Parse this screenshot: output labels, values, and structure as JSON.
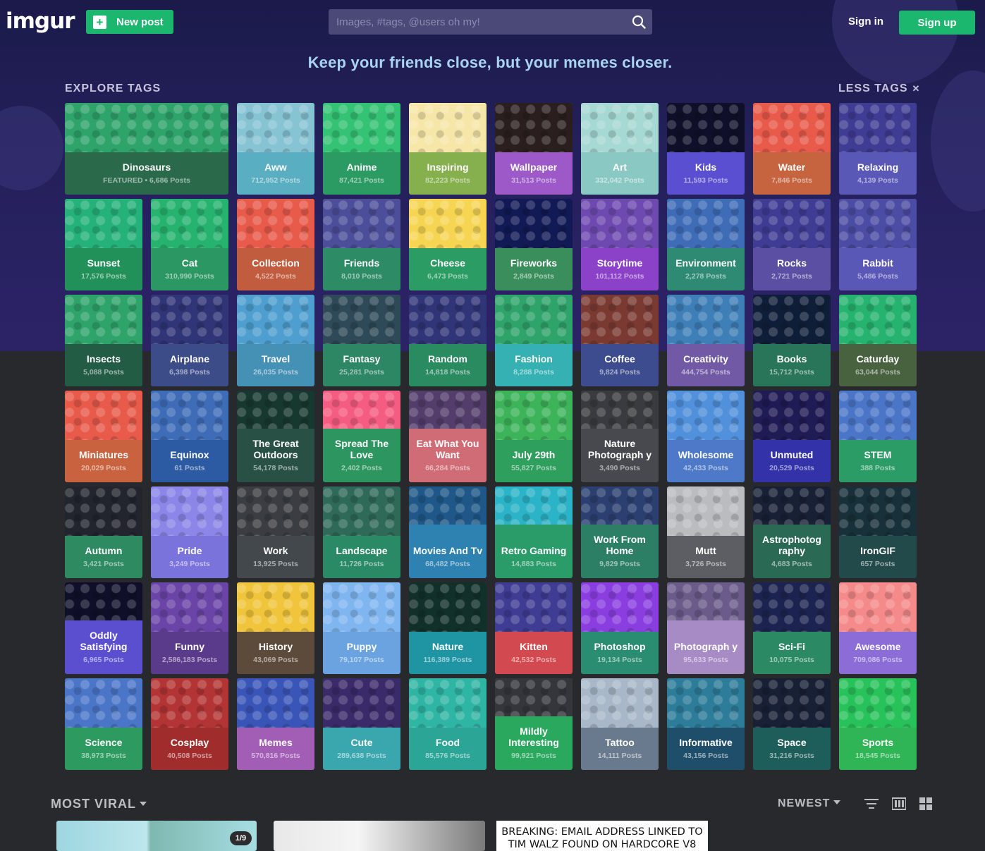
{
  "header": {
    "logo": "imgur",
    "new_post": "New post",
    "search_placeholder": "Images, #tags, @users oh my!",
    "sign_in": "Sign in",
    "sign_up": "Sign up"
  },
  "tagline": "Keep your friends close, but your memes closer.",
  "explore": {
    "title": "EXPLORE TAGS",
    "less_tags": "LESS TAGS",
    "less_tags_icon": "close-icon"
  },
  "tags": [
    {
      "name": "Dinosaurs",
      "count": "FEATURED • 6,686 Posts",
      "color": "#2a6a4a",
      "art": "#2ea36a",
      "featured": true
    },
    {
      "name": "Aww",
      "count": "712,952 Posts",
      "color": "#5aaec1",
      "art": "#86c3d3"
    },
    {
      "name": "Anime",
      "count": "87,421 Posts",
      "color": "#2c9b63",
      "art": "#34c274"
    },
    {
      "name": "Inspiring",
      "count": "82,223 Posts",
      "color": "#86b04e",
      "art": "#f6e6a8"
    },
    {
      "name": "Wallpaper",
      "count": "31,513 Posts",
      "color": "#9c59c7",
      "art": "#2b1e1e"
    },
    {
      "name": "Art",
      "count": "332,042 Posts",
      "color": "#8ac9c3",
      "art": "#a6d8d4"
    },
    {
      "name": "Kids",
      "count": "11,593 Posts",
      "color": "#5a4fd1",
      "art": "#0f0f2a"
    },
    {
      "name": "Water",
      "count": "7,846 Posts",
      "color": "#c6643f",
      "art": "#e85a4a"
    },
    {
      "name": "Relaxing",
      "count": "4,139 Posts",
      "color": "#5a58b7",
      "art": "#3e3c93"
    },
    {
      "name": "Sunset",
      "count": "17,576 Posts",
      "color": "#229059",
      "art": "#25b27a"
    },
    {
      "name": "Cat",
      "count": "310,990 Posts",
      "color": "#2b9763",
      "art": "#26b36f"
    },
    {
      "name": "Collection",
      "count": "4,522 Posts",
      "color": "#c15c3e",
      "art": "#e85a4a"
    },
    {
      "name": "Friends",
      "count": "8,010 Posts",
      "color": "#2d8b66",
      "art": "#4d4e9a"
    },
    {
      "name": "Cheese",
      "count": "6,473 Posts",
      "color": "#2b9c64",
      "art": "#f6d553"
    },
    {
      "name": "Fireworks",
      "count": "2,849 Posts",
      "color": "#3a8e5c",
      "art": "#111a55"
    },
    {
      "name": "Storytime",
      "count": "101,112 Posts",
      "color": "#8c42c8",
      "art": "#6e4ab0"
    },
    {
      "name": "Environment",
      "count": "2,278 Posts",
      "color": "#2e8a73",
      "art": "#3e6cb7"
    },
    {
      "name": "Rocks",
      "count": "2,721 Posts",
      "color": "#5a4fa3",
      "art": "#3e3c93"
    },
    {
      "name": "Rabbit",
      "count": "5,486 Posts",
      "color": "#5a58b7",
      "art": "#4b4ca3"
    },
    {
      "name": "Insects",
      "count": "5,088 Posts",
      "color": "#235c44",
      "art": "#2ea36a"
    },
    {
      "name": "Airplane",
      "count": "6,398 Posts",
      "color": "#3b4c89",
      "art": "#2f3577"
    },
    {
      "name": "Travel",
      "count": "26,035 Posts",
      "color": "#4590b5",
      "art": "#4e9fcf"
    },
    {
      "name": "Fantasy",
      "count": "25,281 Posts",
      "color": "#2d8664",
      "art": "#2e4a58"
    },
    {
      "name": "Random",
      "count": "14,818 Posts",
      "color": "#2a8a60",
      "art": "#2f3577"
    },
    {
      "name": "Fashion",
      "count": "8,288 Posts",
      "color": "#35b1b3",
      "art": "#2ea36a"
    },
    {
      "name": "Coffee",
      "count": "9,824 Posts",
      "color": "#3c4c8e",
      "art": "#7a3a32"
    },
    {
      "name": "Creativity",
      "count": "444,754 Posts",
      "color": "#7159a5",
      "art": "#3e7fb8"
    },
    {
      "name": "Books",
      "count": "15,712 Posts",
      "color": "#28755a",
      "art": "#0f1e38"
    },
    {
      "name": "Caturday",
      "count": "63,044 Posts",
      "color": "#48613e",
      "art": "#26b36f"
    },
    {
      "name": "Miniatures",
      "count": "20,029 Posts",
      "color": "#c8623f",
      "art": "#e85a4a"
    },
    {
      "name": "Equinox",
      "count": "61 Posts",
      "color": "#2c5aa3",
      "art": "#3e6cb7"
    },
    {
      "name": "The Great Outdoors",
      "count": "54,178 Posts",
      "color": "#285045",
      "art": "#17382f",
      "two": true
    },
    {
      "name": "Spread The Love",
      "count": "2,402 Posts",
      "color": "#2d9660",
      "art": "#f55c81",
      "two": true
    },
    {
      "name": "Eat What You Want",
      "count": "66,284 Posts",
      "color": "#d06c76",
      "art": "#533d6b",
      "two": true
    },
    {
      "name": "July 29th",
      "count": "55,827 Posts",
      "color": "#2e9f5c",
      "art": "#3db35a"
    },
    {
      "name": "Nature Photograph y",
      "count": "3,490 Posts",
      "color": "#48494f",
      "art": "#3a3b40",
      "two": true
    },
    {
      "name": "Wholesome",
      "count": "42,433 Posts",
      "color": "#4d79c8",
      "art": "#5190db"
    },
    {
      "name": "Unmuted",
      "count": "20,529 Posts",
      "color": "#3432a8",
      "art": "#1e1b55"
    },
    {
      "name": "STEM",
      "count": "388 Posts",
      "color": "#2b9c66",
      "art": "#4b76c8"
    },
    {
      "name": "Autumn",
      "count": "3,421 Posts",
      "color": "#2e8a60",
      "art": "#22252e"
    },
    {
      "name": "Pride",
      "count": "3,249 Posts",
      "color": "#7b73dc",
      "art": "#8b86e8"
    },
    {
      "name": "Work",
      "count": "13,925 Posts",
      "color": "#42484c",
      "art": "#3a3d42"
    },
    {
      "name": "Landscape",
      "count": "11,726 Posts",
      "color": "#2b8a66",
      "art": "#2f6a58"
    },
    {
      "name": "Movies And Tv",
      "count": "68,482 Posts",
      "color": "#2d82b1",
      "art": "#1f5888",
      "two": true
    },
    {
      "name": "Retro Gaming",
      "count": "14,883 Posts",
      "color": "#2a9c6a",
      "art": "#2bb3c8",
      "two": true
    },
    {
      "name": "Work From Home",
      "count": "9,829 Posts",
      "color": "#2c7e64",
      "art": "#2b3f70",
      "two": true
    },
    {
      "name": "Mutt",
      "count": "3,726 Posts",
      "color": "#5c5e63",
      "art": "#bbbcc0"
    },
    {
      "name": "Astrophotog raphy",
      "count": "4,683 Posts",
      "color": "#2a6a54",
      "art": "#172035",
      "two": true
    },
    {
      "name": "IronGIF",
      "count": "657 Posts",
      "color": "#234a4a",
      "art": "#17303a"
    },
    {
      "name": "Oddly Satisfying",
      "count": "6,965 Posts",
      "color": "#5b4fd0",
      "art": "#0f0f2a",
      "two": true
    },
    {
      "name": "Funny",
      "count": "2,586,183 Posts",
      "color": "#5a3a8a",
      "art": "#6a44a6"
    },
    {
      "name": "History",
      "count": "43,069 Posts",
      "color": "#5c4b3a",
      "art": "#f0c53c"
    },
    {
      "name": "Puppy",
      "count": "79,107 Posts",
      "color": "#6aa3e0",
      "art": "#7fb6f0"
    },
    {
      "name": "Nature",
      "count": "116,389 Posts",
      "color": "#1f95a4",
      "art": "#12302a"
    },
    {
      "name": "Kitten",
      "count": "42,532 Posts",
      "color": "#d24a4f",
      "art": "#3e3c93"
    },
    {
      "name": "Photoshop",
      "count": "19,134 Posts",
      "color": "#2a8c70",
      "art": "#8a3ee0"
    },
    {
      "name": "Photograph y",
      "count": "95,633 Posts",
      "color": "#a78bc5",
      "art": "#6a5b8a",
      "two": true
    },
    {
      "name": "Sci-Fi",
      "count": "10,075 Posts",
      "color": "#2b8a64",
      "art": "#1d2350"
    },
    {
      "name": "Awesome",
      "count": "709,086 Posts",
      "color": "#8c6dd8",
      "art": "#f58a8a"
    },
    {
      "name": "Science",
      "count": "38,973 Posts",
      "color": "#2d9a5f",
      "art": "#4b76c8"
    },
    {
      "name": "Cosplay",
      "count": "40,508 Posts",
      "color": "#a02c2c",
      "art": "#b33434"
    },
    {
      "name": "Memes",
      "count": "570,816 Posts",
      "color": "#a25db5",
      "art": "#3a55b8"
    },
    {
      "name": "Cute",
      "count": "289,638 Posts",
      "color": "#3aa6ad",
      "art": "#3a2a6a"
    },
    {
      "name": "Food",
      "count": "85,576 Posts",
      "color": "#2aa596",
      "art": "#2fb5a4"
    },
    {
      "name": "Mildly Interesting",
      "count": "99,921 Posts",
      "color": "#2aa85e",
      "art": "#34363c",
      "two": true
    },
    {
      "name": "Tattoo",
      "count": "14,111 Posts",
      "color": "#6a7a8e",
      "art": "#a8b8c8"
    },
    {
      "name": "Informative",
      "count": "43,156 Posts",
      "color": "#1f4e6a",
      "art": "#2d7d9a"
    },
    {
      "name": "Space",
      "count": "31,216 Posts",
      "color": "#1e5e5a",
      "art": "#172035"
    },
    {
      "name": "Sports",
      "count": "18,545 Posts",
      "color": "#2fb556",
      "art": "#28c25a"
    }
  ],
  "feed": {
    "most_viral": "MOST VIRAL",
    "sort": "NEWEST",
    "view_icons": [
      "filter-icon",
      "compact-view-icon",
      "grid-view-icon"
    ],
    "pager": "1/9",
    "headline": "BREAKING: EMAIL ADDRESS LINKED TO TIM WALZ FOUND ON HARDCORE V8"
  }
}
